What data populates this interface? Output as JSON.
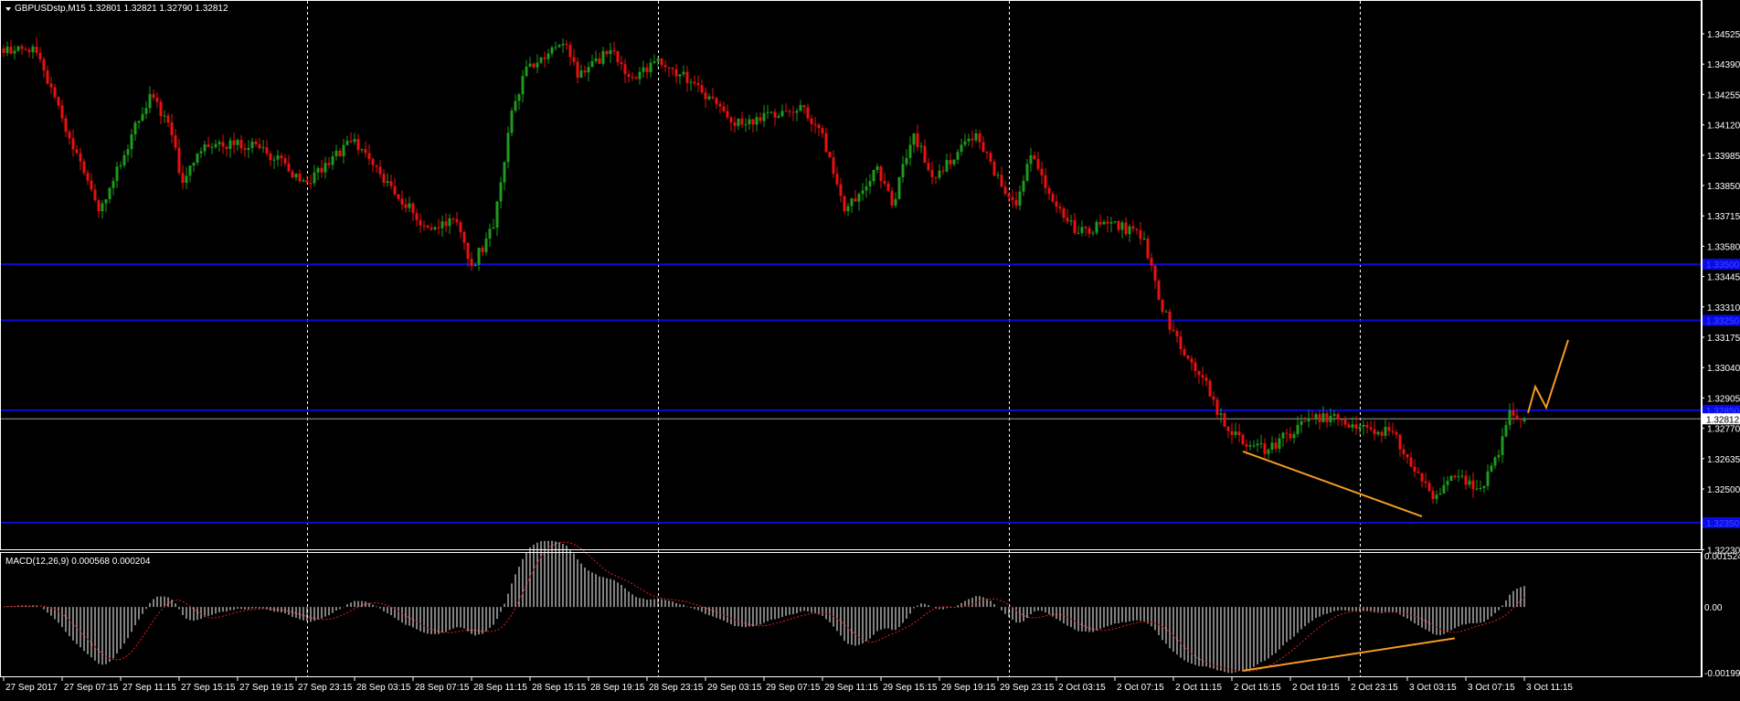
{
  "header": {
    "title": "GBPUSDstp,M15  1.32801 1.32821 1.32790 1.32812"
  },
  "macd_header": {
    "title": "MACD(12,26,9) 0.000568 0.000204"
  },
  "colors": {
    "background": "#000000",
    "bull": "#1e9a1e",
    "bear": "#e81010",
    "level": "#0a0ad8",
    "bid": "#a0a0a0",
    "trend": "#f59a23",
    "macd_hist": "#ffffff",
    "macd_signal": "#e02020",
    "grid": "#ffffff"
  },
  "chart_data": {
    "type": "candlestick",
    "symbol": "GBPUSDstp",
    "timeframe": "M15",
    "ohlc_last": {
      "open": 1.32801,
      "high": 1.32821,
      "low": 1.3279,
      "close": 1.32812
    },
    "bar_count": 417,
    "close_keypoints": [
      [
        0,
        1.3444
      ],
      [
        8,
        1.34468
      ],
      [
        26,
        1.33736
      ],
      [
        40,
        1.34257
      ],
      [
        45,
        1.34131
      ],
      [
        49,
        1.33862
      ],
      [
        55,
        1.34033
      ],
      [
        69,
        1.34033
      ],
      [
        83,
        1.33862
      ],
      [
        96,
        1.34057
      ],
      [
        104,
        1.33862
      ],
      [
        116,
        1.33663
      ],
      [
        124,
        1.33687
      ],
      [
        128,
        1.33492
      ],
      [
        134,
        1.33663
      ],
      [
        139,
        1.34183
      ],
      [
        143,
        1.34379
      ],
      [
        154,
        1.34476
      ],
      [
        157,
        1.3433
      ],
      [
        166,
        1.34452
      ],
      [
        172,
        1.3433
      ],
      [
        178,
        1.34403
      ],
      [
        189,
        1.34305
      ],
      [
        199,
        1.34131
      ],
      [
        212,
        1.34159
      ],
      [
        218,
        1.34208
      ],
      [
        224,
        1.34082
      ],
      [
        230,
        1.33736
      ],
      [
        239,
        1.33935
      ],
      [
        243,
        1.33761
      ],
      [
        249,
        1.34082
      ],
      [
        254,
        1.33887
      ],
      [
        266,
        1.34082
      ],
      [
        274,
        1.33813
      ],
      [
        277,
        1.33761
      ],
      [
        281,
        1.33984
      ],
      [
        286,
        1.33813
      ],
      [
        294,
        1.33639
      ],
      [
        303,
        1.33687
      ],
      [
        312,
        1.33614
      ],
      [
        316,
        1.33342
      ],
      [
        322,
        1.33122
      ],
      [
        328,
        1.32996
      ],
      [
        334,
        1.32777
      ],
      [
        339,
        1.32699
      ],
      [
        346,
        1.32675
      ],
      [
        356,
        1.32801
      ],
      [
        363,
        1.32825
      ],
      [
        371,
        1.32777
      ],
      [
        380,
        1.32752
      ],
      [
        386,
        1.32577
      ],
      [
        391,
        1.32455
      ],
      [
        397,
        1.32553
      ],
      [
        404,
        1.32504
      ],
      [
        409,
        1.32651
      ],
      [
        412,
        1.3285
      ],
      [
        416,
        1.32812
      ]
    ],
    "price_axis": {
      "labels": [
        "1.34525",
        "1.34390",
        "1.34255",
        "1.34120",
        "1.33985",
        "1.33850",
        "1.33715",
        "1.33580",
        "1.33445",
        "1.33310",
        "1.33175",
        "1.33040",
        "1.32905",
        "1.32770",
        "1.32635",
        "1.32500",
        "1.32230"
      ]
    },
    "horizontal_levels": [
      {
        "price": 1.335,
        "label": "1.33500"
      },
      {
        "price": 1.3325,
        "label": "1.33250"
      },
      {
        "price": 1.3285,
        "label": "1.32850"
      },
      {
        "price": 1.3235,
        "label": "1.32350"
      }
    ],
    "bid": {
      "price": 1.32812,
      "label": "1.32812"
    },
    "trendlines": [
      {
        "name": "divergence-trendline",
        "points": [
          [
            339,
            1.32667
          ],
          [
            388,
            1.32378
          ]
        ]
      },
      {
        "name": "projection-zigzag",
        "points": [
          [
            417,
            1.32838
          ],
          [
            419,
            1.32955
          ],
          [
            422,
            1.32862
          ],
          [
            428,
            1.33163
          ]
        ]
      }
    ],
    "macd_trendline": {
      "points": [
        [
          339,
          -0.00183
        ],
        [
          397,
          -0.0009
        ]
      ]
    },
    "macd": {
      "fast": 12,
      "slow": 26,
      "signal": 9,
      "main": 0.000568,
      "signal_value": 0.000204,
      "axis_labels": [
        "0.001524",
        "0.00",
        "-0.001991"
      ],
      "ylim": [
        -0.001991,
        0.001524
      ]
    },
    "time_axis": {
      "labels": [
        "27 Sep 2017",
        "27 Sep 07:15",
        "27 Sep 11:15",
        "27 Sep 15:15",
        "27 Sep 19:15",
        "27 Sep 23:15",
        "28 Sep 03:15",
        "28 Sep 07:15",
        "28 Sep 11:15",
        "28 Sep 15:15",
        "28 Sep 19:15",
        "28 Sep 23:15",
        "29 Sep 03:15",
        "29 Sep 07:15",
        "29 Sep 11:15",
        "29 Sep 15:15",
        "29 Sep 19:15",
        "29 Sep 23:15",
        "2 Oct 03:15",
        "2 Oct 07:15",
        "2 Oct 11:15",
        "2 Oct 15:15",
        "2 Oct 19:15",
        "2 Oct 23:15",
        "3 Oct 03:15",
        "3 Oct 07:15",
        "3 Oct 11:15"
      ],
      "bars_per_label": 16,
      "day_separator_bars": [
        83,
        179,
        275,
        371
      ]
    }
  }
}
